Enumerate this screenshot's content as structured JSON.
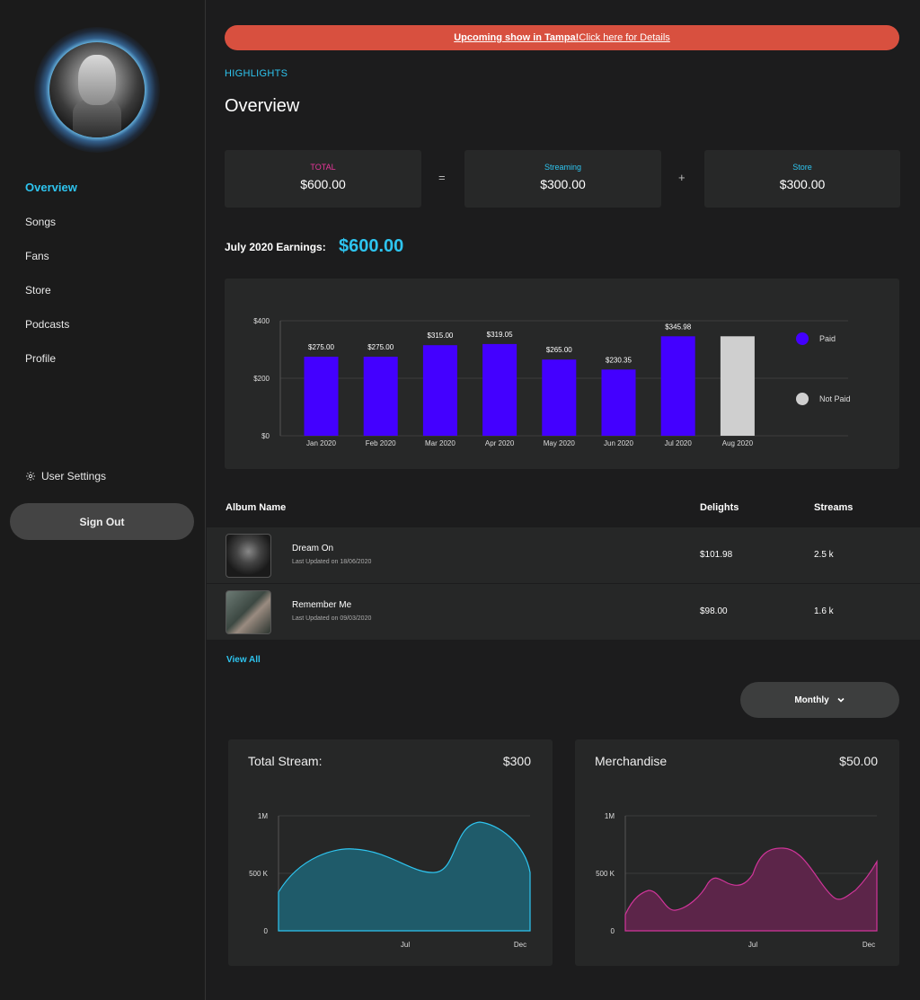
{
  "sidebar": {
    "nav": [
      "Overview",
      "Songs",
      "Fans",
      "Store",
      "Podcasts",
      "Profile"
    ],
    "settings_label": "User Settings",
    "signout_label": "Sign Out"
  },
  "banner": {
    "bold": "Upcoming show in Tampa!",
    "rest": " Click here for Details"
  },
  "highlights_label": "HIGHLIGHTS",
  "page_title": "Overview",
  "summary": {
    "total_label": "TOTAL",
    "total_value": "$600.00",
    "streaming_label": "Streaming",
    "streaming_value": "$300.00",
    "store_label": "Store",
    "store_value": "$300.00",
    "equals": "=",
    "plus": "+"
  },
  "earnings": {
    "label": "July 2020 Earnings:",
    "value": "$600.00"
  },
  "chart_data": {
    "type": "bar",
    "categories": [
      "Jan 2020",
      "Feb 2020",
      "Mar 2020",
      "Apr 2020",
      "May 2020",
      "Jun 2020",
      "Jul 2020",
      "Aug 2020"
    ],
    "values": [
      275.0,
      275.0,
      315.0,
      319.05,
      265.0,
      230.35,
      345.98,
      345.98
    ],
    "labels": [
      "$275.00",
      "$275.00",
      "$315.00",
      "$319.05",
      "$265.00",
      "$230.35",
      "$345.98",
      ""
    ],
    "status": [
      "Paid",
      "Paid",
      "Paid",
      "Paid",
      "Paid",
      "Paid",
      "Paid",
      "Not Paid"
    ],
    "yticks": [
      "$0",
      "$200",
      "$400"
    ],
    "ylim": [
      0,
      400
    ],
    "legend": [
      {
        "label": "Paid",
        "color": "#4300ff"
      },
      {
        "label": "Not Paid",
        "color": "#cfcfcf"
      }
    ],
    "legend_position": "right",
    "grid": true
  },
  "table": {
    "headers": {
      "album": "Album Name",
      "delights": "Delights",
      "streams": "Streams"
    },
    "rows": [
      {
        "name": "Dream On",
        "updated": "Last Updated on 18/06/2020",
        "delights": "$101.98",
        "streams": "2.5 k"
      },
      {
        "name": "Remember Me",
        "updated": "Last Updated on 09/03/2020",
        "delights": "$98.00",
        "streams": "1.6 k"
      }
    ],
    "view_all": "View All"
  },
  "period_select": "Monthly",
  "mini_charts": [
    {
      "title": "Total Stream:",
      "value": "$300",
      "color": "#2ec4ef",
      "fill": "#1f5b6a",
      "yticks": [
        "0",
        "500 K",
        "1M"
      ],
      "xticks": [
        "Jul",
        "Dec"
      ]
    },
    {
      "title": "Merchandise",
      "value": "$50.00",
      "color": "#d0359a",
      "fill": "#5c2549",
      "yticks": [
        "0",
        "500 K",
        "1M"
      ],
      "xticks": [
        "Jul",
        "Dec"
      ]
    }
  ]
}
